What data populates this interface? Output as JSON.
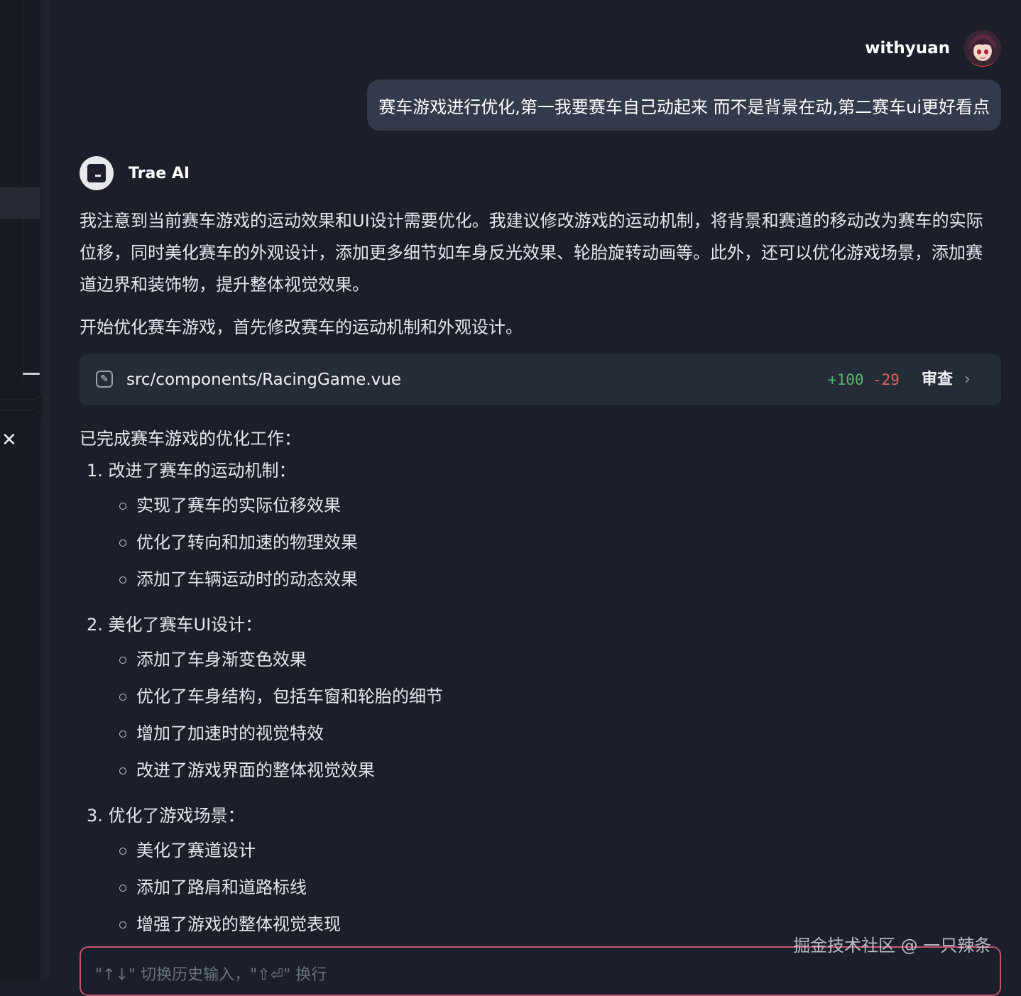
{
  "user": {
    "name": "withyuan",
    "message": "赛车游戏进行优化,第一我要赛车自己动起来  而不是背景在动,第二赛车ui更好看点"
  },
  "assistant": {
    "name": "Trae AI",
    "intro": "我注意到当前赛车游戏的运动效果和UI设计需要优化。我建议修改游戏的运动机制，将背景和赛道的移动改为赛车的实际位移，同时美化赛车的外观设计，添加更多细节如车身反光效果、轮胎旋转动画等。此外，还可以优化游戏场景，添加赛道边界和装饰物，提升整体视觉效果。",
    "start": "开始优化赛车游戏，首先修改赛车的运动机制和外观设计。",
    "file_change": {
      "path": "src/components/RacingGame.vue",
      "additions": "+100",
      "deletions": "-29",
      "review_label": "审查"
    },
    "summary_title": "已完成赛车游戏的优化工作：",
    "sections": [
      {
        "title": "1. 改进了赛车的运动机制：",
        "items": [
          "实现了赛车的实际位移效果",
          "优化了转向和加速的物理效果",
          "添加了车辆运动时的动态效果"
        ]
      },
      {
        "title": "2. 美化了赛车UI设计：",
        "items": [
          "添加了车身渐变色效果",
          "优化了车身结构，包括车窗和轮胎的细节",
          "增加了加速时的视觉特效",
          "改进了游戏界面的整体视觉效果"
        ]
      },
      {
        "title": "3. 优化了游戏场景：",
        "items": [
          "美化了赛道设计",
          "添加了路肩和道路标线",
          "增强了游戏的整体视觉表现"
        ]
      }
    ]
  },
  "input": {
    "placeholder": "\"↑↓\" 切换历史输入，\"⇧⏎\" 换行"
  },
  "watermark": "掘金技术社区 @ 一只辣条",
  "colors": {
    "background": "#1b1f2a",
    "bubble": "#343a4b",
    "card": "#262b38",
    "additions": "#58b46f",
    "deletions": "#e0655b",
    "input_border": "#c5526f"
  }
}
